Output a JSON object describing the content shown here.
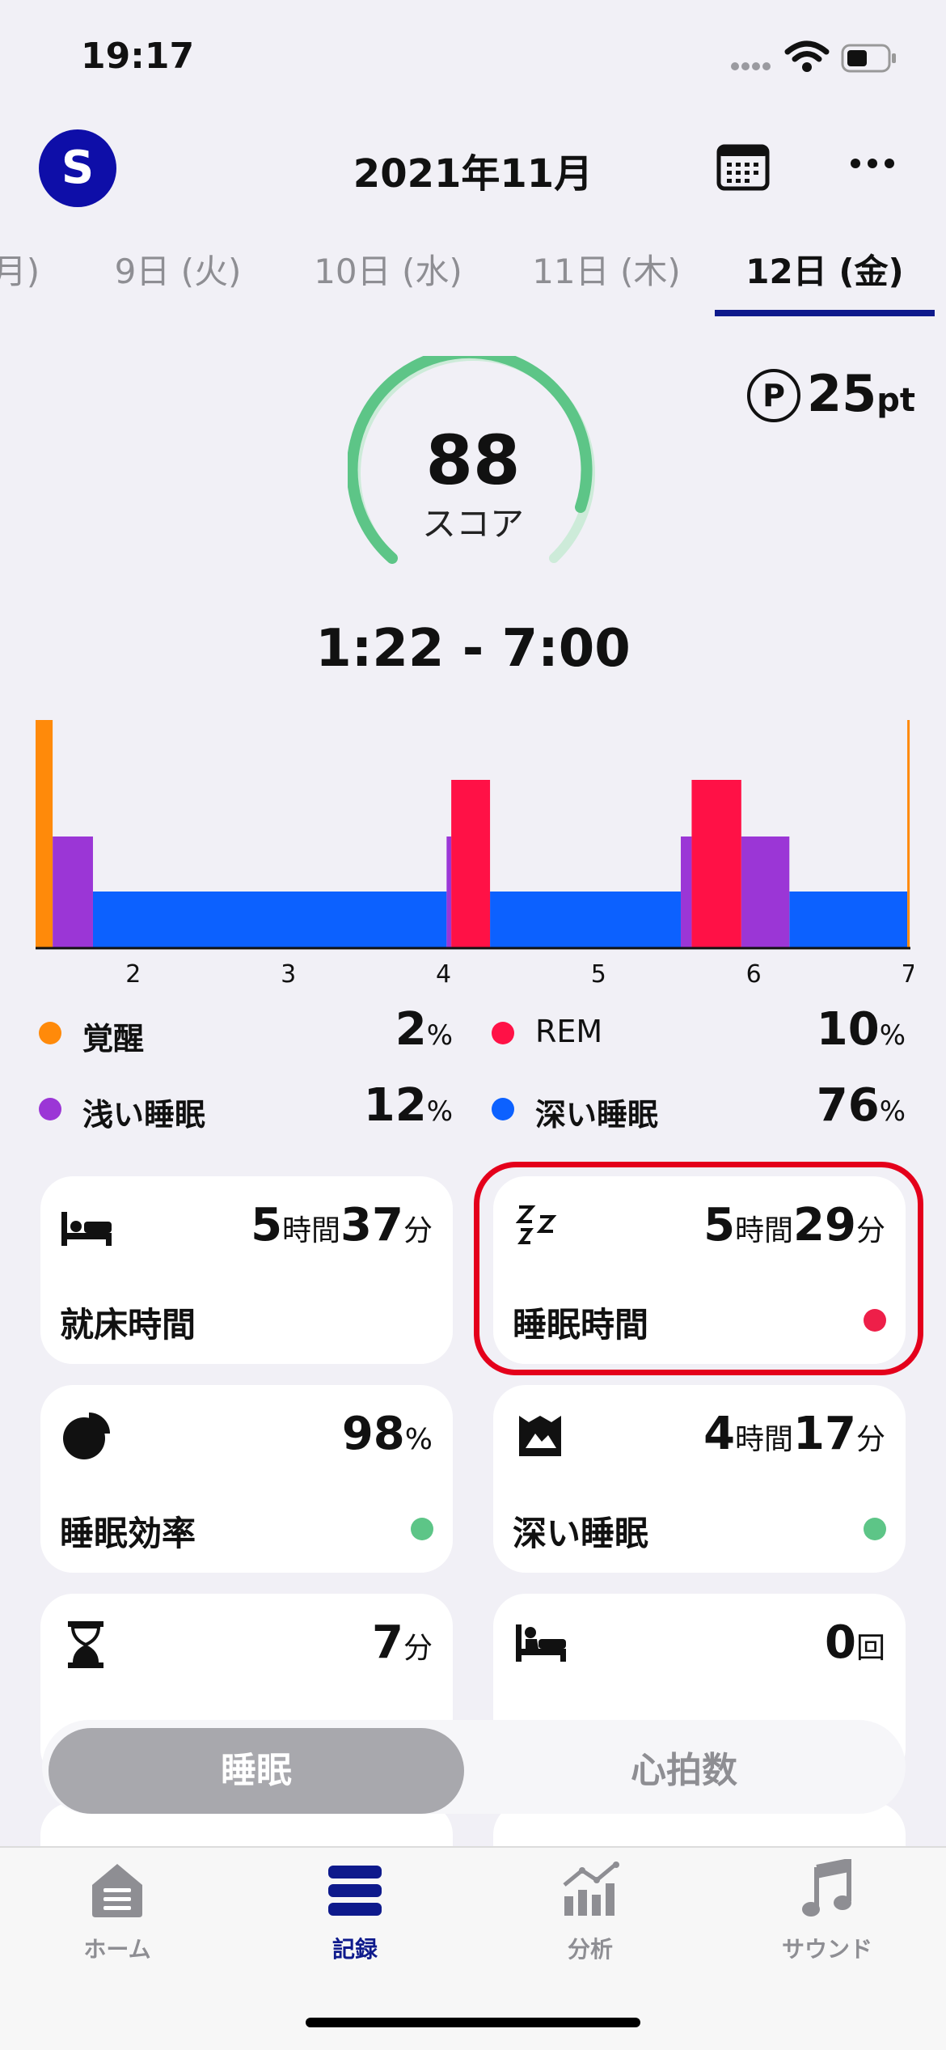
{
  "status_bar": {
    "time": "19:17"
  },
  "header": {
    "avatar_letter": "S",
    "month": "2021年11月"
  },
  "date_tabs": [
    {
      "label": "月)",
      "active": false
    },
    {
      "label": "9日 (火)",
      "active": false
    },
    {
      "label": "10日 (水)",
      "active": false
    },
    {
      "label": "11日 (木)",
      "active": false
    },
    {
      "label": "12日 (金)",
      "active": true
    }
  ],
  "points": {
    "symbol": "P",
    "value": "25",
    "unit": "pt"
  },
  "score": {
    "value": "88",
    "label": "スコア",
    "gauge_fraction": 0.88
  },
  "sleep_range": "1:22 - 7:00",
  "chart_data": {
    "type": "bar",
    "x_ticks": [
      "2",
      "3",
      "4",
      "5",
      "6",
      "7"
    ],
    "stages": [
      "覚醒",
      "REM",
      "浅い睡眠",
      "深い睡眠"
    ],
    "segments": [
      {
        "stage": "覚醒",
        "start": 1.37,
        "end": 1.48
      },
      {
        "stage": "浅い睡眠",
        "start": 1.48,
        "end": 1.74
      },
      {
        "stage": "深い睡眠",
        "start": 1.74,
        "end": 4.02
      },
      {
        "stage": "浅い睡眠",
        "start": 4.02,
        "end": 4.05
      },
      {
        "stage": "REM",
        "start": 4.05,
        "end": 4.3
      },
      {
        "stage": "深い睡眠",
        "start": 4.3,
        "end": 5.53
      },
      {
        "stage": "浅い睡眠",
        "start": 5.53,
        "end": 5.6
      },
      {
        "stage": "REM",
        "start": 5.6,
        "end": 5.92
      },
      {
        "stage": "浅い睡眠",
        "start": 5.92,
        "end": 6.23
      },
      {
        "stage": "深い睡眠",
        "start": 6.23,
        "end": 6.99
      },
      {
        "stage": "覚醒",
        "start": 6.99,
        "end": 7.0
      }
    ],
    "xlim": [
      1.37,
      7.0
    ],
    "colors": {
      "覚醒": "#ff8a0a",
      "REM": "#ff1146",
      "浅い睡眠": "#9b36d6",
      "深い睡眠": "#0c61ff"
    }
  },
  "legend": [
    {
      "label": "覚醒",
      "value": "2",
      "unit": "%",
      "color": "#ff8a0a"
    },
    {
      "label": "REM",
      "value": "10",
      "unit": "%",
      "color": "#ff1146"
    },
    {
      "label": "浅い睡眠",
      "value": "12",
      "unit": "%",
      "color": "#9b36d6"
    },
    {
      "label": "深い睡眠",
      "value": "76",
      "unit": "%",
      "color": "#0c61ff"
    }
  ],
  "cards": {
    "time_in_bed": {
      "icon": "bed-icon",
      "h": "5",
      "h_unit": "時間",
      "m": "37",
      "m_unit": "分",
      "label": "就床時間"
    },
    "sleep_time": {
      "icon": "zzz-icon",
      "h": "5",
      "h_unit": "時間",
      "m": "29",
      "m_unit": "分",
      "label": "睡眠時間",
      "dot_color": "#ee1f49"
    },
    "sleep_efficiency": {
      "icon": "pie-icon",
      "value": "98",
      "unit": "%",
      "label": "睡眠効率",
      "dot_color": "#5dc587"
    },
    "deep_sleep": {
      "icon": "mountain-flag-icon",
      "h": "4",
      "h_unit": "時間",
      "m": "17",
      "m_unit": "分",
      "label": "深い睡眠",
      "dot_color": "#5dc587"
    },
    "latency": {
      "icon": "hourglass-icon",
      "value": "7",
      "unit": "分"
    },
    "wake_count": {
      "icon": "bed-wake-icon",
      "value": "0",
      "unit": "回"
    }
  },
  "segmented": {
    "active": "睡眠",
    "inactive": "心拍数"
  },
  "nav": [
    {
      "label": "ホーム",
      "icon": "home-icon",
      "active": false
    },
    {
      "label": "記録",
      "icon": "list-icon",
      "active": true
    },
    {
      "label": "分析",
      "icon": "analytics-icon",
      "active": false
    },
    {
      "label": "サウンド",
      "icon": "music-note-icon",
      "active": false
    }
  ]
}
